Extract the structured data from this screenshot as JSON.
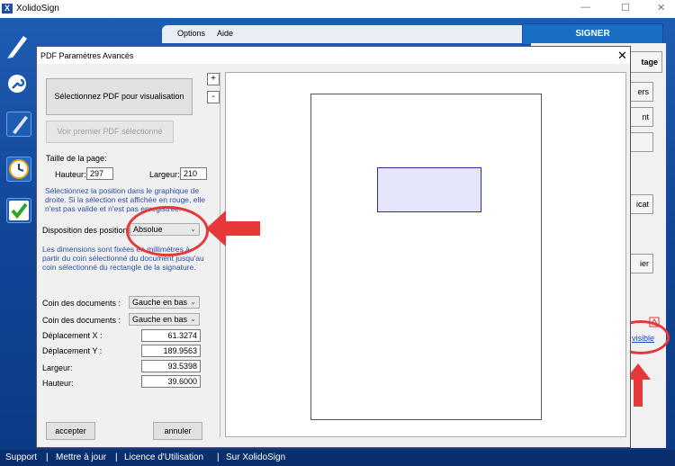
{
  "app": {
    "title": "XolidoSign",
    "logo_glyph": "X"
  },
  "window_controls": {
    "minimize": "—",
    "maximize": "☐",
    "close": "✕"
  },
  "menu": {
    "items": [
      "Options",
      "Aide"
    ]
  },
  "toolbar": {
    "sign_label": "SIGNER"
  },
  "right_panel": {
    "buttons": [
      "tage",
      "ers",
      "nt",
      "icat",
      "ier"
    ],
    "link_text": "visible"
  },
  "footer": {
    "links": [
      "Support",
      "Mettre à jour",
      "Licence d'Utilisation",
      "Sur XolidoSign"
    ],
    "separator": "|"
  },
  "dialog": {
    "title": "PDF Paramètres Avancés",
    "close": "✕",
    "select_pdf_label": "Sélectionnez PDF pour visualisation",
    "view_first_pdf_label": "Voir premier PDF sélectionné",
    "page_size_label": "Taille de la page:",
    "height_label": "Hauteur:",
    "height_value": "297",
    "width_label": "Largeur:",
    "width_value": "210",
    "select_info": "Sélectionnez la position dans le graphique de droite. Si la sélection est affichée en rouge, elle n'est pas valide et n'est pas enregistrée.",
    "position_layout_label": "Disposition des positions :",
    "position_layout_value": "Absolue",
    "dimensions_info": "Les dimensions sont fixées en millimètres à partir du coin sélectionné du document jusqu'au coin sélectionné du rectangle de la signature.",
    "corner1_label": "Coin des documents :",
    "corner1_value": "Gauche en bas",
    "corner2_label": "Coin des documents :",
    "corner2_value": "Gauche en bas",
    "offset_x_label": "Déplacement X :",
    "offset_x_value": "61.3274",
    "offset_y_label": "Déplacement Y :",
    "offset_y_value": "189.9563",
    "width2_label": "Largeur:",
    "width2_value": "93.5398",
    "height2_label": "Hauteur:",
    "height2_value": "39.6000",
    "accept_label": "accepter",
    "cancel_label": "annuler",
    "zoom_in": "+",
    "zoom_out": "-"
  },
  "colors": {
    "accent": "#1a6fc4",
    "highlight": "#e63838",
    "info_text": "#2d4fa8",
    "app_bg": "#124597"
  }
}
